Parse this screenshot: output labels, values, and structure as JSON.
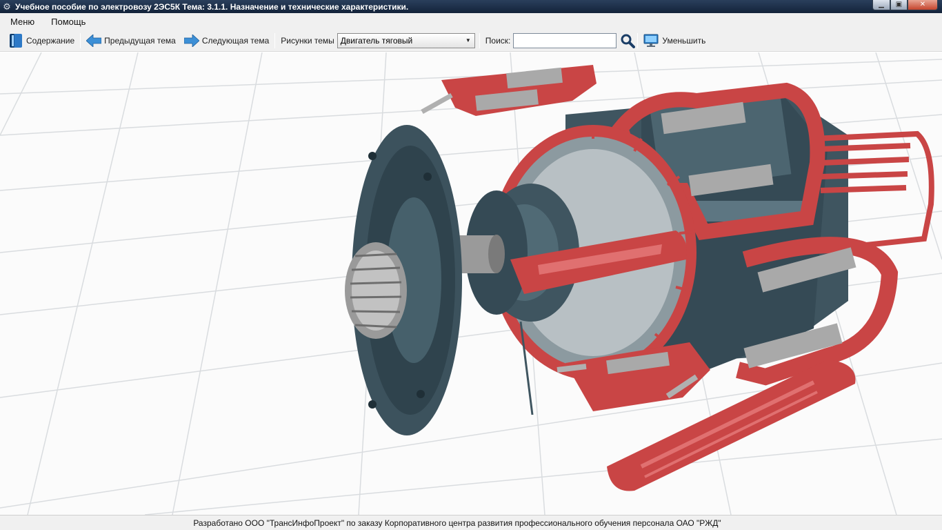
{
  "window": {
    "title": "Учебное пособие по электровозу 2ЭС5К Тема: 3.1.1. Назначение и технические характеристики.",
    "icon": "gear-icon"
  },
  "menu": {
    "items": [
      "Меню",
      "Помощь"
    ]
  },
  "toolbar": {
    "contents_label": "Содержание",
    "prev_label": "Предыдущая тема",
    "next_label": "Следующая тема",
    "figures_label": "Рисунки темы",
    "figure_selected": "Двигатель тяговый",
    "search_label": "Поиск:",
    "search_value": "",
    "shrink_label": "Уменьшить"
  },
  "icons": {
    "contents": "book-icon",
    "prev": "arrow-left-icon",
    "next": "arrow-right-icon",
    "search": "magnifier-icon",
    "shrink": "monitor-icon"
  },
  "status": {
    "text": "Разработано ООО \"ТрансИнфоПроект\" по заказу Корпоративного центра развития профессионального обучения персонала ОАО \"РЖД\""
  },
  "colors": {
    "titlebar": "#1b2d47",
    "chrome": "#f0f0f0",
    "arrow": "#3c8fd6",
    "motor_red": "#c94545",
    "motor_slate": "#3f5560",
    "motor_grey": "#a9a9a9"
  }
}
